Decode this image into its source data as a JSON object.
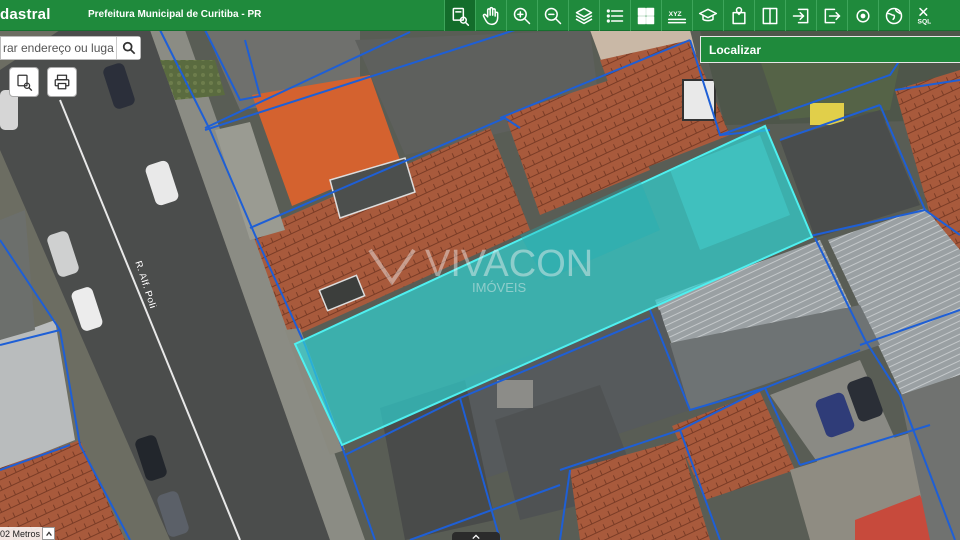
{
  "header": {
    "app_title": "dastral",
    "org_name": "Prefeitura Municipal de Curitiba - PR"
  },
  "toolbar": {
    "items": [
      {
        "name": "identify-icon",
        "active": true
      },
      {
        "name": "hand-pan-icon"
      },
      {
        "name": "zoom-in-icon"
      },
      {
        "name": "zoom-out-icon"
      },
      {
        "name": "layers-icon"
      },
      {
        "name": "list-icon"
      },
      {
        "name": "grid-icon"
      },
      {
        "name": "xyz-icon",
        "label": "XYZ"
      },
      {
        "name": "graduation-cap-icon"
      },
      {
        "name": "map-pin-document-icon"
      },
      {
        "name": "split-view-icon"
      },
      {
        "name": "import-icon"
      },
      {
        "name": "export-icon"
      },
      {
        "name": "target-icon"
      },
      {
        "name": "globe-icon"
      },
      {
        "name": "sql-icon",
        "label": "SQL"
      }
    ]
  },
  "search": {
    "placeholder": "rar endereço ou luga"
  },
  "panel": {
    "title": "Localizar"
  },
  "map": {
    "street_label": "R. Alf. Poli",
    "watermark_main": "VIVACON",
    "watermark_sub": "IMÓVEIS",
    "scale_text": "02 Metros"
  },
  "colors": {
    "accent": "#1f8a3c",
    "parcel_outline": "#1e5fd6",
    "selection_fill": "#2fd6d6"
  }
}
